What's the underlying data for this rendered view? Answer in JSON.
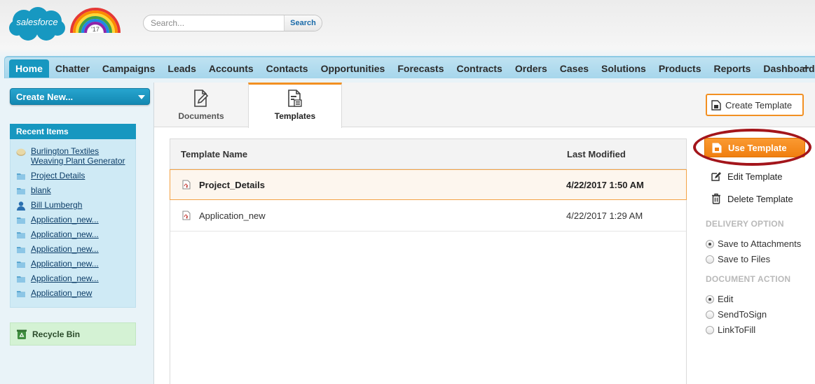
{
  "header": {
    "logo_text": "salesforce",
    "logo_badge": "'17",
    "search": {
      "placeholder": "Search...",
      "button_label": "Search"
    }
  },
  "tabs": [
    "Home",
    "Chatter",
    "Campaigns",
    "Leads",
    "Accounts",
    "Contacts",
    "Opportunities",
    "Forecasts",
    "Contracts",
    "Orders",
    "Cases",
    "Solutions",
    "Products",
    "Reports",
    "Dashboards"
  ],
  "tabs_more": "+",
  "active_tab": "Home",
  "sidebar": {
    "create_new_label": "Create New...",
    "recent_title": "Recent Items",
    "recent_items": [
      {
        "label": "Burlington Textiles Weaving Plant Generator",
        "icon": "opportunity-icon"
      },
      {
        "label": "Project Details",
        "icon": "folder-icon"
      },
      {
        "label": "blank",
        "icon": "folder-icon"
      },
      {
        "label": "Bill Lumbergh",
        "icon": "contact-icon"
      },
      {
        "label": "Application_new...",
        "icon": "folder-icon"
      },
      {
        "label": "Application_new...",
        "icon": "folder-icon"
      },
      {
        "label": "Application_new...",
        "icon": "folder-icon"
      },
      {
        "label": "Application_new...",
        "icon": "folder-icon"
      },
      {
        "label": "Application_new...",
        "icon": "folder-icon"
      },
      {
        "label": "Application_new",
        "icon": "folder-icon"
      }
    ],
    "recycle_bin_label": "Recycle Bin"
  },
  "main": {
    "doc_tabs": [
      {
        "label": "Documents",
        "icon": "document-edit-icon",
        "active": false
      },
      {
        "label": "Templates",
        "icon": "template-icon",
        "active": true
      }
    ],
    "create_template_label": "Create Template",
    "table": {
      "columns": [
        "Template Name",
        "Last Modified"
      ],
      "rows": [
        {
          "name": "Project_Details",
          "modified": "4/22/2017 1:50 AM",
          "selected": true
        },
        {
          "name": "Application_new",
          "modified": "4/22/2017 1:29 AM",
          "selected": false
        }
      ]
    },
    "actions": {
      "use_template": "Use Template",
      "edit_template": "Edit Template",
      "delete_template": "Delete Template",
      "delivery_title": "DELIVERY OPTION",
      "delivery_options": [
        {
          "label": "Save to Attachments",
          "checked": true
        },
        {
          "label": "Save to Files",
          "checked": false
        }
      ],
      "document_action_title": "DOCUMENT ACTION",
      "document_actions": [
        {
          "label": "Edit",
          "checked": true
        },
        {
          "label": "SendToSign",
          "checked": false
        },
        {
          "label": "LinkToFill",
          "checked": false
        }
      ]
    }
  },
  "colors": {
    "brand_blue": "#1797c0",
    "accent_orange": "#f29022",
    "highlight_ring": "#a3151b"
  }
}
